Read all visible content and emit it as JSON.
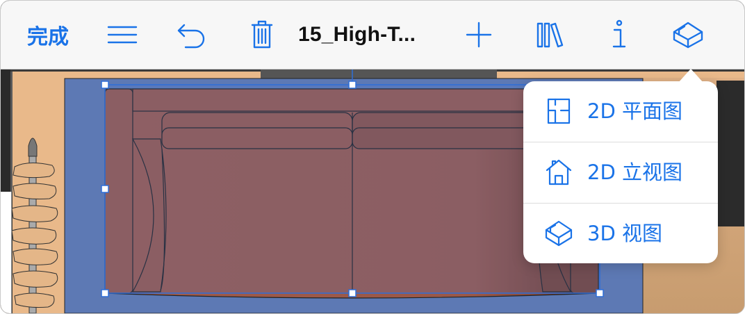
{
  "toolbar": {
    "done_label": "完成",
    "title": "15_High-T...",
    "icons": [
      "menu-icon",
      "undo-icon",
      "trash-icon",
      "add-icon",
      "library-icon",
      "info-icon",
      "3d-view-icon"
    ]
  },
  "view_menu": {
    "items": [
      {
        "label": "2D 平面图",
        "icon": "floorplan-icon"
      },
      {
        "label": "2D 立视图",
        "icon": "elevation-icon"
      },
      {
        "label": "3D 视图",
        "icon": "3d-icon"
      }
    ]
  },
  "colors": {
    "accent": "#1a73e8",
    "rug": "#5d79b4",
    "sofa": "#9a5848",
    "floor": "#e9b98a"
  }
}
